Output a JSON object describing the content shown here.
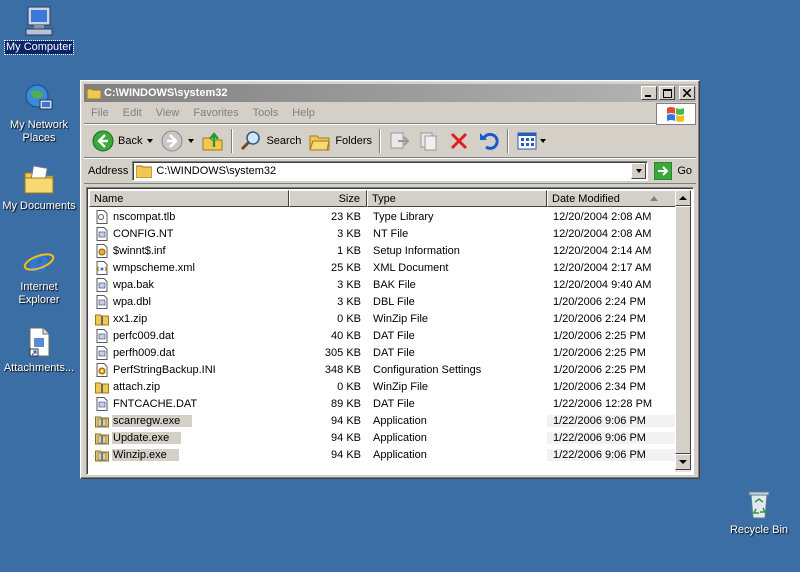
{
  "desktop": {
    "icons": [
      {
        "label": "My Computer"
      },
      {
        "label": "My Network Places"
      },
      {
        "label": "My Documents"
      },
      {
        "label": "Internet Explorer"
      },
      {
        "label": "Attachments..."
      },
      {
        "label": "Recycle Bin"
      }
    ],
    "background_color": "#3a6ea5"
  },
  "window": {
    "title": "C:\\WINDOWS\\system32",
    "menu": [
      "File",
      "Edit",
      "View",
      "Favorites",
      "Tools",
      "Help"
    ],
    "toolbar": {
      "back_label": "Back",
      "search_label": "Search",
      "folders_label": "Folders"
    },
    "address": {
      "label": "Address",
      "value": "C:\\WINDOWS\\system32",
      "go_label": "Go"
    },
    "columns": {
      "name": "Name",
      "size": "Size",
      "type": "Type",
      "date": "Date Modified"
    },
    "files": [
      {
        "name": "nscompat.tlb",
        "size": "23 KB",
        "type": "Type Library",
        "date": "12/20/2004 2:08 AM",
        "icon": "tlb-icon",
        "selected": false
      },
      {
        "name": "CONFIG.NT",
        "size": "3 KB",
        "type": "NT File",
        "date": "12/20/2004 2:08 AM",
        "icon": "file-icon",
        "selected": false
      },
      {
        "name": "$winnt$.inf",
        "size": "1 KB",
        "type": "Setup Information",
        "date": "12/20/2004 2:14 AM",
        "icon": "inf-icon",
        "selected": false
      },
      {
        "name": "wmpscheme.xml",
        "size": "25 KB",
        "type": "XML Document",
        "date": "12/20/2004 2:17 AM",
        "icon": "xml-icon",
        "selected": false
      },
      {
        "name": "wpa.bak",
        "size": "3 KB",
        "type": "BAK File",
        "date": "12/20/2004 9:40 AM",
        "icon": "file-icon",
        "selected": false
      },
      {
        "name": "wpa.dbl",
        "size": "3 KB",
        "type": "DBL File",
        "date": "1/20/2006 2:24 PM",
        "icon": "file-icon",
        "selected": false
      },
      {
        "name": "xx1.zip",
        "size": "0 KB",
        "type": "WinZip File",
        "date": "1/20/2006 2:24 PM",
        "icon": "zip-icon",
        "selected": false
      },
      {
        "name": "perfc009.dat",
        "size": "40 KB",
        "type": "DAT File",
        "date": "1/20/2006 2:25 PM",
        "icon": "file-icon",
        "selected": false
      },
      {
        "name": "perfh009.dat",
        "size": "305 KB",
        "type": "DAT File",
        "date": "1/20/2006 2:25 PM",
        "icon": "file-icon",
        "selected": false
      },
      {
        "name": "PerfStringBackup.INI",
        "size": "348 KB",
        "type": "Configuration Settings",
        "date": "1/20/2006 2:25 PM",
        "icon": "ini-icon",
        "selected": false
      },
      {
        "name": "attach.zip",
        "size": "0 KB",
        "type": "WinZip File",
        "date": "1/20/2006 2:34 PM",
        "icon": "zip-icon",
        "selected": false
      },
      {
        "name": "FNTCACHE.DAT",
        "size": "89 KB",
        "type": "DAT File",
        "date": "1/22/2006 12:28 PM",
        "icon": "file-icon",
        "selected": false
      },
      {
        "name": "scanregw.exe",
        "size": "94 KB",
        "type": "Application",
        "date": "1/22/2006 9:06 PM",
        "icon": "winzip-exe-icon",
        "selected": true
      },
      {
        "name": "Update.exe",
        "size": "94 KB",
        "type": "Application",
        "date": "1/22/2006 9:06 PM",
        "icon": "winzip-exe-icon",
        "selected": true
      },
      {
        "name": "Winzip.exe",
        "size": "94 KB",
        "type": "Application",
        "date": "1/22/2006 9:06 PM",
        "icon": "winzip-exe-icon",
        "selected": true
      }
    ]
  }
}
